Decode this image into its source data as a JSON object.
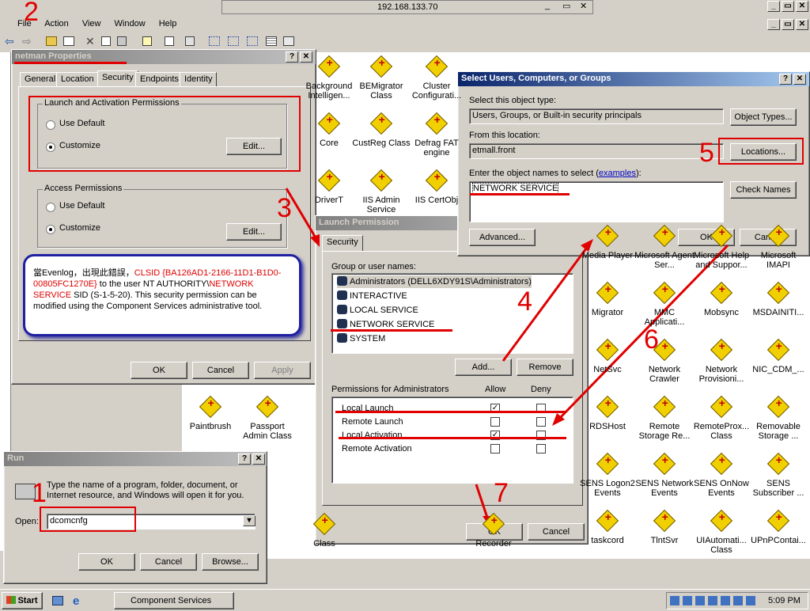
{
  "mmc": {
    "title": "192.168.133.70",
    "menu": [
      "File",
      "Action",
      "View",
      "Window",
      "Help"
    ]
  },
  "icons_row": [
    {
      "label": "Background Intelligen..."
    },
    {
      "label": "BEMigrator Class"
    },
    {
      "label": "Cluster Configurati..."
    },
    {
      "label": "Core"
    },
    {
      "label": "CustReg Class"
    },
    {
      "label": "Defrag FAT engine"
    },
    {
      "label": "DriverT"
    },
    {
      "label": "IIS Admin Service"
    },
    {
      "label": "IIS CertObj"
    }
  ],
  "icons_right": [
    {
      "label": "Media Player"
    },
    {
      "label": "Microsoft Agent Ser..."
    },
    {
      "label": "Microsoft Help and Suppor..."
    },
    {
      "label": "Microsoft IMAPI"
    },
    {
      "label": "Migrator"
    },
    {
      "label": "MMC Applicati..."
    },
    {
      "label": "Mobsync"
    },
    {
      "label": "MSDAINITI..."
    },
    {
      "label": "NetSvc"
    },
    {
      "label": "Network Crawler"
    },
    {
      "label": "Network Provisioni..."
    },
    {
      "label": "NIC_CDM_..."
    },
    {
      "label": "RDSHost"
    },
    {
      "label": "Remote Storage Re..."
    },
    {
      "label": "RemoteProx... Class"
    },
    {
      "label": "Removable Storage ..."
    },
    {
      "label": "SENS Logon2 Events"
    },
    {
      "label": "SENS Network Events"
    },
    {
      "label": "SENS OnNow Events"
    },
    {
      "label": "SENS Subscriber ..."
    },
    {
      "label": "taskcord"
    },
    {
      "label": "TlntSvr"
    },
    {
      "label": "UIAutomati... Class"
    },
    {
      "label": "UPnPContai..."
    }
  ],
  "icons_bottom": [
    {
      "label": "Paintbrush"
    },
    {
      "label": "Passport Admin Class"
    },
    {
      "label": "Class"
    },
    {
      "label": "Recorder"
    }
  ],
  "netman": {
    "title": "netman Properties",
    "tabs": [
      "General",
      "Location",
      "Security",
      "Endpoints",
      "Identity"
    ],
    "launch_group": "Launch and Activation Permissions",
    "access_group": "Access Permissions",
    "use_default": "Use Default",
    "customize": "Customize",
    "edit": "Edit...",
    "ok": "OK",
    "cancel": "Cancel",
    "apply": "Apply",
    "note_prefix": "當Evenlog，出現此錯誤，",
    "note_red1": "CLSID {BA126AD1-2166-11D1-B1D0-00805FC1270E}",
    "note_mid": " to the user NT AUTHORITY\\",
    "note_red2": "NETWORK SERVICE",
    "note_suffix": " SID (S-1-5-20).  This security permission can be modified using the Component Services administrative tool."
  },
  "launch_perm": {
    "title": "Launch Permission",
    "tab": "Security",
    "group_label": "Group or user names:",
    "users": [
      "Administrators (DELL6XDY91S\\Administrators)",
      "INTERACTIVE",
      "LOCAL SERVICE",
      "NETWORK SERVICE",
      "SYSTEM"
    ],
    "add": "Add...",
    "remove": "Remove",
    "perm_label": "Permissions for Administrators",
    "allow": "Allow",
    "deny": "Deny",
    "permissions": [
      {
        "name": "Local Launch",
        "allow": true,
        "deny": false
      },
      {
        "name": "Remote Launch",
        "allow": false,
        "deny": false
      },
      {
        "name": "Local Activation",
        "allow": true,
        "deny": false
      },
      {
        "name": "Remote Activation",
        "allow": false,
        "deny": false
      }
    ],
    "ok": "OK",
    "cancel": "Cancel"
  },
  "select_users": {
    "title": "Select Users, Computers, or Groups",
    "type_label": "Select this object type:",
    "type_value": "Users, Groups, or Built-in security principals",
    "object_types": "Object Types...",
    "location_label": "From this location:",
    "location_value": "etmall.front",
    "locations": "Locations...",
    "names_label_prefix": "Enter the object names to select (",
    "examples": "examples",
    "names_label_suffix": "):",
    "names_value": "NETWORK SERVICE",
    "check_names": "Check Names",
    "advanced": "Advanced...",
    "ok": "OK",
    "cancel": "Cancel"
  },
  "run": {
    "title": "Run",
    "prompt": "Type the name of a program, folder, document, or Internet resource, and Windows will open it for you.",
    "open_label": "Open:",
    "open_value": "dcomcnfg",
    "ok": "OK",
    "cancel": "Cancel",
    "browse": "Browse..."
  },
  "taskbar": {
    "start": "Start",
    "task": "Component Services",
    "clock": "5:09 PM"
  },
  "steps": [
    "1",
    "2",
    "3",
    "4",
    "5",
    "6",
    "7"
  ],
  "colors": {
    "annotation": "#e00000",
    "titlebar": "#0a246a",
    "note_border": "#2020a0"
  }
}
